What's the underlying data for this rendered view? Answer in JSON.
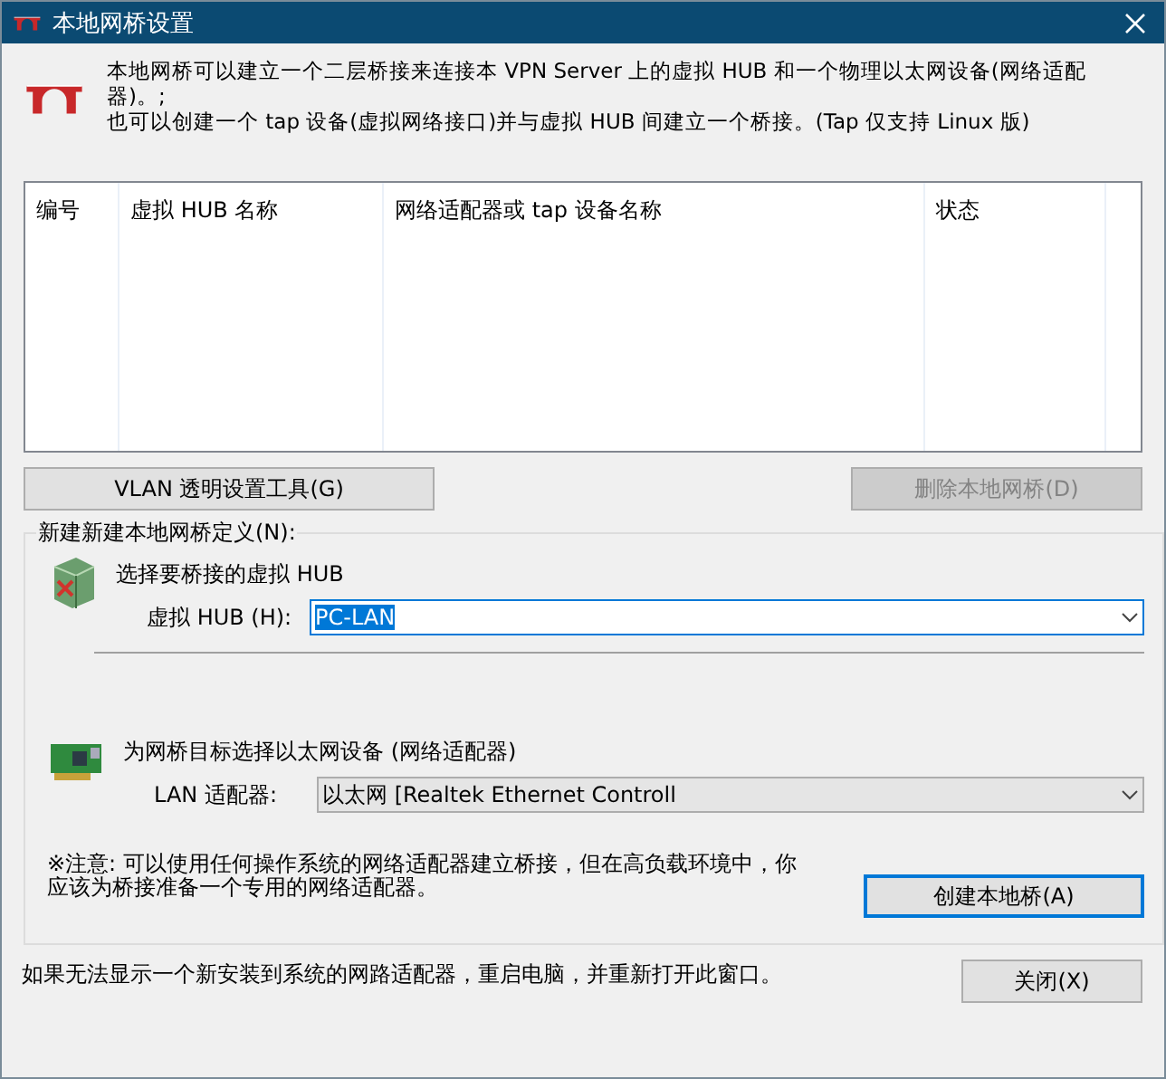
{
  "window": {
    "title": "本地网桥设置"
  },
  "description": [
    "本地网桥可以建立一个二层桥接来连接本 VPN Server 上的虚拟 HUB 和一个物理以太网设备(网络适配器)。;",
    "也可以创建一个 tap 设备(虚拟网络接口)并与虚拟 HUB 间建立一个桥接。(Tap 仅支持 Linux 版)"
  ],
  "table": {
    "columns": [
      "编号",
      "虚拟 HUB 名称",
      "网络适配器或 tap 设备名称",
      "状态"
    ]
  },
  "table_buttons": [
    {
      "label": "VLAN 透明设置工具(G)",
      "disabled": false
    },
    {
      "label": "删除本地网桥(D)",
      "disabled": true
    }
  ],
  "new_bridge": {
    "title": "新建新建本地网桥定义(N):",
    "sections": [
      {
        "kind": "hub",
        "heading": "选择要桥接的虚拟 HUB",
        "field_label": "虚拟 HUB (H):",
        "value": "PC-LAN",
        "focused": true
      },
      {
        "kind": "adapter",
        "heading": "为网桥目标选择以太网设备 (网络适配器)",
        "field_label": "LAN 适配器:",
        "value": "以太网 [Realtek Ethernet Controll",
        "focused": false
      }
    ],
    "note": "※注意: 可以使用任何操作系统的网络适配器建立桥接，但在高负载环境中，你应该为桥接准备一个专用的网络适配器。",
    "create_button": {
      "label": "创建本地桥(A)",
      "default": true
    }
  },
  "footer": {
    "text": "如果无法显示一个新安装到系统的网路适配器，重启电脑，并重新打开此窗口。",
    "close_button": "关闭(X)"
  }
}
